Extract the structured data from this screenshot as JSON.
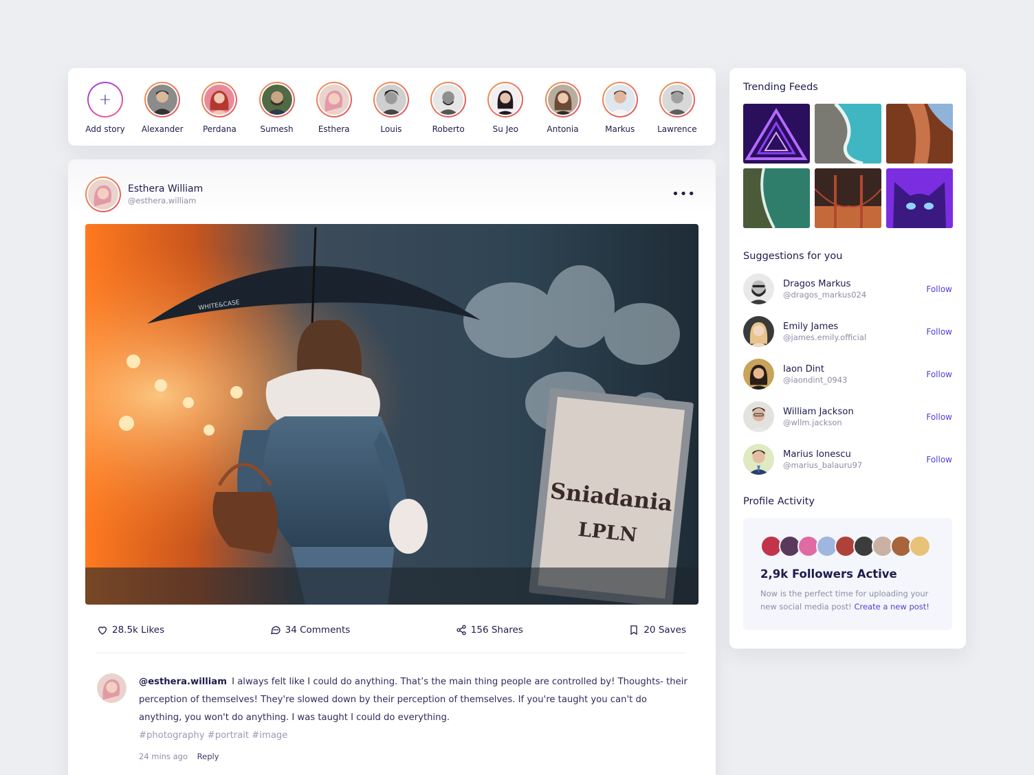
{
  "stories": {
    "add_label": "Add story",
    "items": [
      {
        "name": "Alexander",
        "color": "#6d5b4e"
      },
      {
        "name": "Perdana",
        "color": "#c44a4a"
      },
      {
        "name": "Sumesh",
        "color": "#556b4f"
      },
      {
        "name": "Esthera",
        "color": "#d59a8c"
      },
      {
        "name": "Louis",
        "color": "#6a6a6a"
      },
      {
        "name": "Roberto",
        "color": "#4a4a4a"
      },
      {
        "name": "Su Jeo",
        "color": "#3a3340"
      },
      {
        "name": "Antonia",
        "color": "#8a6a55"
      },
      {
        "name": "Markus",
        "color": "#9bb1c2"
      },
      {
        "name": "Lawrence",
        "color": "#7c7c7c"
      }
    ]
  },
  "post": {
    "author_name": "Esthera William",
    "author_handle": "@esthera.william",
    "more_icon": "more-horizontal-icon",
    "image_signage": [
      "Sniadania",
      "LPLN"
    ],
    "image_umbrella_text": "WHITE&CASE",
    "actions": {
      "likes": "28.5k Likes",
      "comments": "34 Comments",
      "shares": "156 Shares",
      "saves": "20 Saves"
    },
    "comment": {
      "user": "@esthera.william",
      "text": "I always felt like I could do anything. That’s the main thing people are controlled by! Thoughts- their perception of themselves! They're slowed down by their perception of themselves. If you're taught you can't do anything, you won't do anything. I was taught I could do everything.",
      "tags": "#photography #portrait #image",
      "time": "24 mins ago",
      "reply": "Reply"
    }
  },
  "sidebar": {
    "trending_title": "Trending Feeds",
    "suggestions_title": "Suggestions for you",
    "follow_label": "Follow",
    "suggestions": [
      {
        "name": "Dragos Markus",
        "handle": "@dragos_markus024",
        "color": "#3a3a3a"
      },
      {
        "name": "Emily James",
        "handle": "@james.emily.official",
        "color": "#c9a074"
      },
      {
        "name": "Iaon Dint",
        "handle": "@iaondint_0943",
        "color": "#7a5a3f"
      },
      {
        "name": "William Jackson",
        "handle": "@wllm.jackson",
        "color": "#b8a99b"
      },
      {
        "name": "Marius Ionescu",
        "handle": "@marius_balauru97",
        "color": "#8aa36a"
      }
    ],
    "activity_title": "Profile Activity",
    "activity_count": "2,9k Followers Active",
    "activity_text": "Now is the perfect time for uploading your new social media post!",
    "activity_link": "Create a new post!"
  },
  "colors": {
    "accent": "#4d3fd6",
    "text_dark": "#1d1b4c",
    "text_muted": "#8d8ca6",
    "background": "#eceef1"
  }
}
